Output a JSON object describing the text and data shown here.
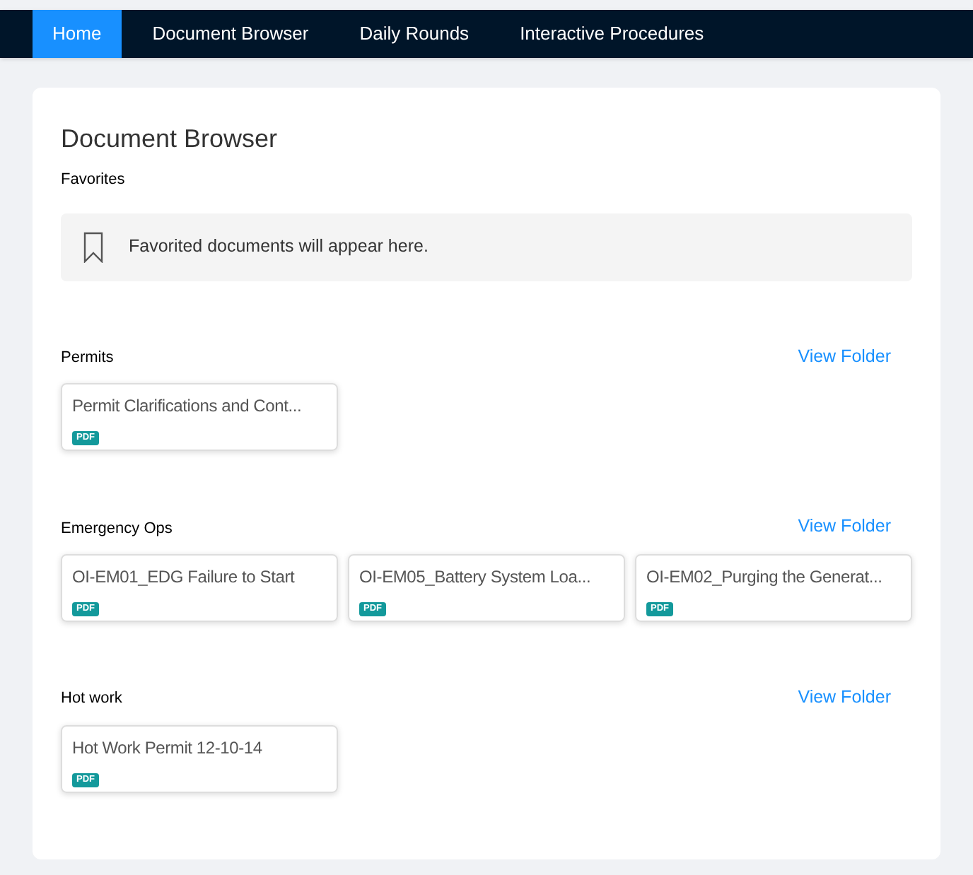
{
  "nav": {
    "tabs": [
      {
        "label": "Home",
        "selected": true
      },
      {
        "label": "Document Browser",
        "selected": false
      },
      {
        "label": "Daily Rounds",
        "selected": false
      },
      {
        "label": "Interactive Procedures",
        "selected": false
      }
    ]
  },
  "page": {
    "title": "Document Browser",
    "favorites": {
      "heading": "Favorites",
      "empty_message": "Favorited documents will appear here."
    },
    "folders": [
      {
        "name": "Permits",
        "link": "View Folder",
        "documents": [
          {
            "title": "Permit Clarifications and Cont...",
            "badge": "PDF"
          }
        ]
      },
      {
        "name": "Emergency Ops",
        "link": "View Folder",
        "documents": [
          {
            "title": "OI-EM01_EDG Failure to Start",
            "badge": "PDF"
          },
          {
            "title": "OI-EM05_Battery System Loa...",
            "badge": "PDF"
          },
          {
            "title": "OI-EM02_Purging the Generat...",
            "badge": "PDF"
          }
        ]
      },
      {
        "name": "Hot work",
        "link": "View Folder",
        "documents": [
          {
            "title": "Hot Work Permit 12-10-14",
            "badge": "PDF"
          }
        ]
      }
    ]
  }
}
